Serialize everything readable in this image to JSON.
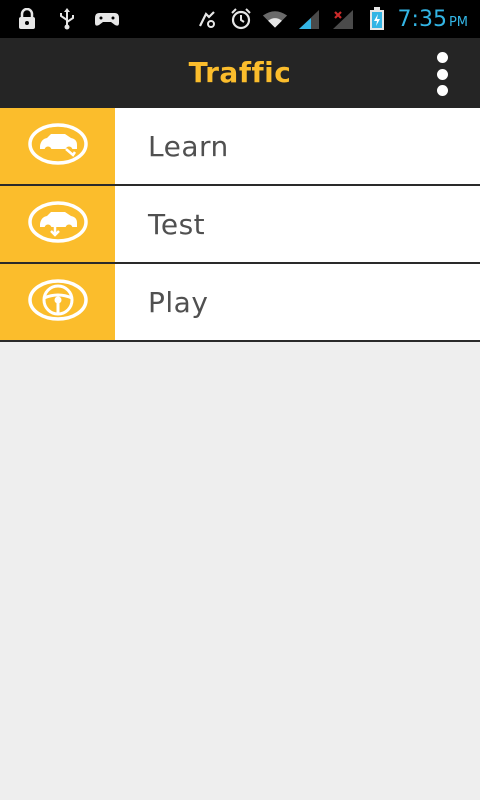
{
  "status_bar": {
    "time": "7:35",
    "ampm": "PM",
    "icons": [
      "lock-icon",
      "usb-icon",
      "gamepad-icon",
      "no-sound-icon",
      "alarm-icon",
      "wifi-icon",
      "signal-icon",
      "signal-x-icon",
      "battery-icon"
    ],
    "time_color": "#33b5e5"
  },
  "action_bar": {
    "title": "Traffic",
    "title_color": "#fbbd2c",
    "overflow_icon": "overflow-menu-icon"
  },
  "menu": {
    "items": [
      {
        "label": "Learn",
        "icon": "car-learn-icon"
      },
      {
        "label": "Test",
        "icon": "car-test-icon"
      },
      {
        "label": "Play",
        "icon": "steering-wheel-icon"
      }
    ],
    "accent": "#fbbd2c"
  }
}
